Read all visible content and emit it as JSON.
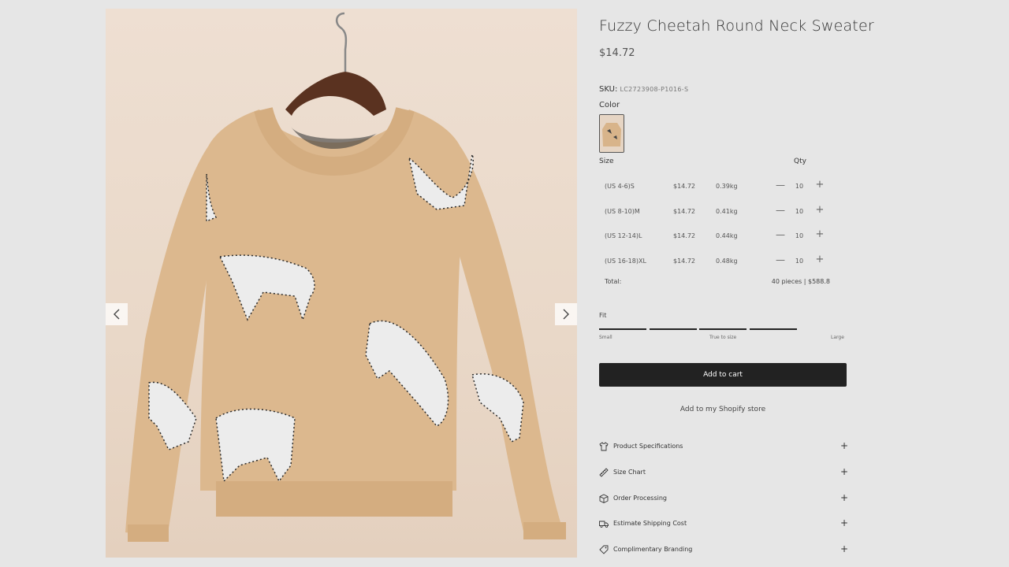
{
  "product": {
    "title": "Fuzzy Cheetah Round Neck Sweater",
    "price": "$14.72",
    "sku_label": "SKU:",
    "sku_value": "LC2723908-P1016-S",
    "color_label": "Color"
  },
  "gallery": {
    "prev_icon": "chevron-left-icon",
    "next_icon": "chevron-right-icon",
    "colors": {
      "sweater": "#dcb88e",
      "background": "#eadbcc",
      "print_dark": "#2a2a2a",
      "print_light": "#eeeeee"
    }
  },
  "sizes": {
    "size_header": "Size",
    "qty_header": "Qty",
    "rows": [
      {
        "size": "(US 4-6)S",
        "price": "$14.72",
        "weight": "0.39kg",
        "qty": "10"
      },
      {
        "size": "(US 8-10)M",
        "price": "$14.72",
        "weight": "0.41kg",
        "qty": "10"
      },
      {
        "size": "(US 12-14)L",
        "price": "$14.72",
        "weight": "0.44kg",
        "qty": "10"
      },
      {
        "size": "(US 16-18)XL",
        "price": "$14.72",
        "weight": "0.48kg",
        "qty": "10"
      }
    ],
    "minus_symbol": "—",
    "plus_symbol": "+",
    "total_label": "Total:",
    "total_value": "40 pieces | $588.8"
  },
  "fit": {
    "label": "Fit",
    "small": "Small",
    "true_to_size": "True to size",
    "large": "Large"
  },
  "actions": {
    "add_to_cart": "Add to cart",
    "add_to_shopify": "Add to my Shopify store"
  },
  "accordion": [
    {
      "label": "Product Specifications",
      "icon": "shirt-icon"
    },
    {
      "label": "Size Chart",
      "icon": "ruler-icon"
    },
    {
      "label": "Order Processing",
      "icon": "box-icon"
    },
    {
      "label": "Estimate Shipping Cost",
      "icon": "truck-icon"
    },
    {
      "label": "Complimentary Branding",
      "icon": "tag-icon"
    }
  ],
  "accordion_plus": "+"
}
